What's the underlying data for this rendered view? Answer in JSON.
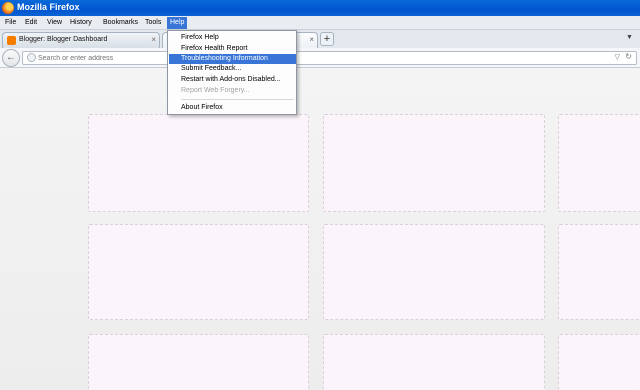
{
  "window": {
    "title": "Mozilla Firefox"
  },
  "menubar": {
    "items": [
      {
        "label": "File"
      },
      {
        "label": "Edit"
      },
      {
        "label": "View"
      },
      {
        "label": "History"
      },
      {
        "label": "Bookmarks"
      },
      {
        "label": "Tools"
      },
      {
        "label": "Help",
        "active": true
      }
    ]
  },
  "tabs": [
    {
      "label": "Blogger: Blogger Dashboard",
      "close": "×"
    },
    {
      "label": "",
      "close": "×"
    }
  ],
  "newtab_label": "+",
  "tablist_label": "▼",
  "navbar": {
    "back_label": "←",
    "url_placeholder": "Search or enter address",
    "dropdown_label": "▽",
    "reload_label": "↻"
  },
  "help_menu": {
    "items": [
      {
        "label": "Firefox Help"
      },
      {
        "label": "Firefox Health Report"
      },
      {
        "label": "Troubleshooting Information",
        "highlighted": true
      },
      {
        "label": "Submit Feedback..."
      },
      {
        "label": "Restart with Add-ons Disabled..."
      },
      {
        "label": "Report Web Forgery...",
        "disabled": true
      },
      {
        "label": "About Firefox"
      }
    ]
  },
  "colors": {
    "titlebar": "#0055d0",
    "menu_highlight": "#3875d7",
    "tile_background": "#fbf4fb",
    "tile_border": "#d9d0d9"
  }
}
